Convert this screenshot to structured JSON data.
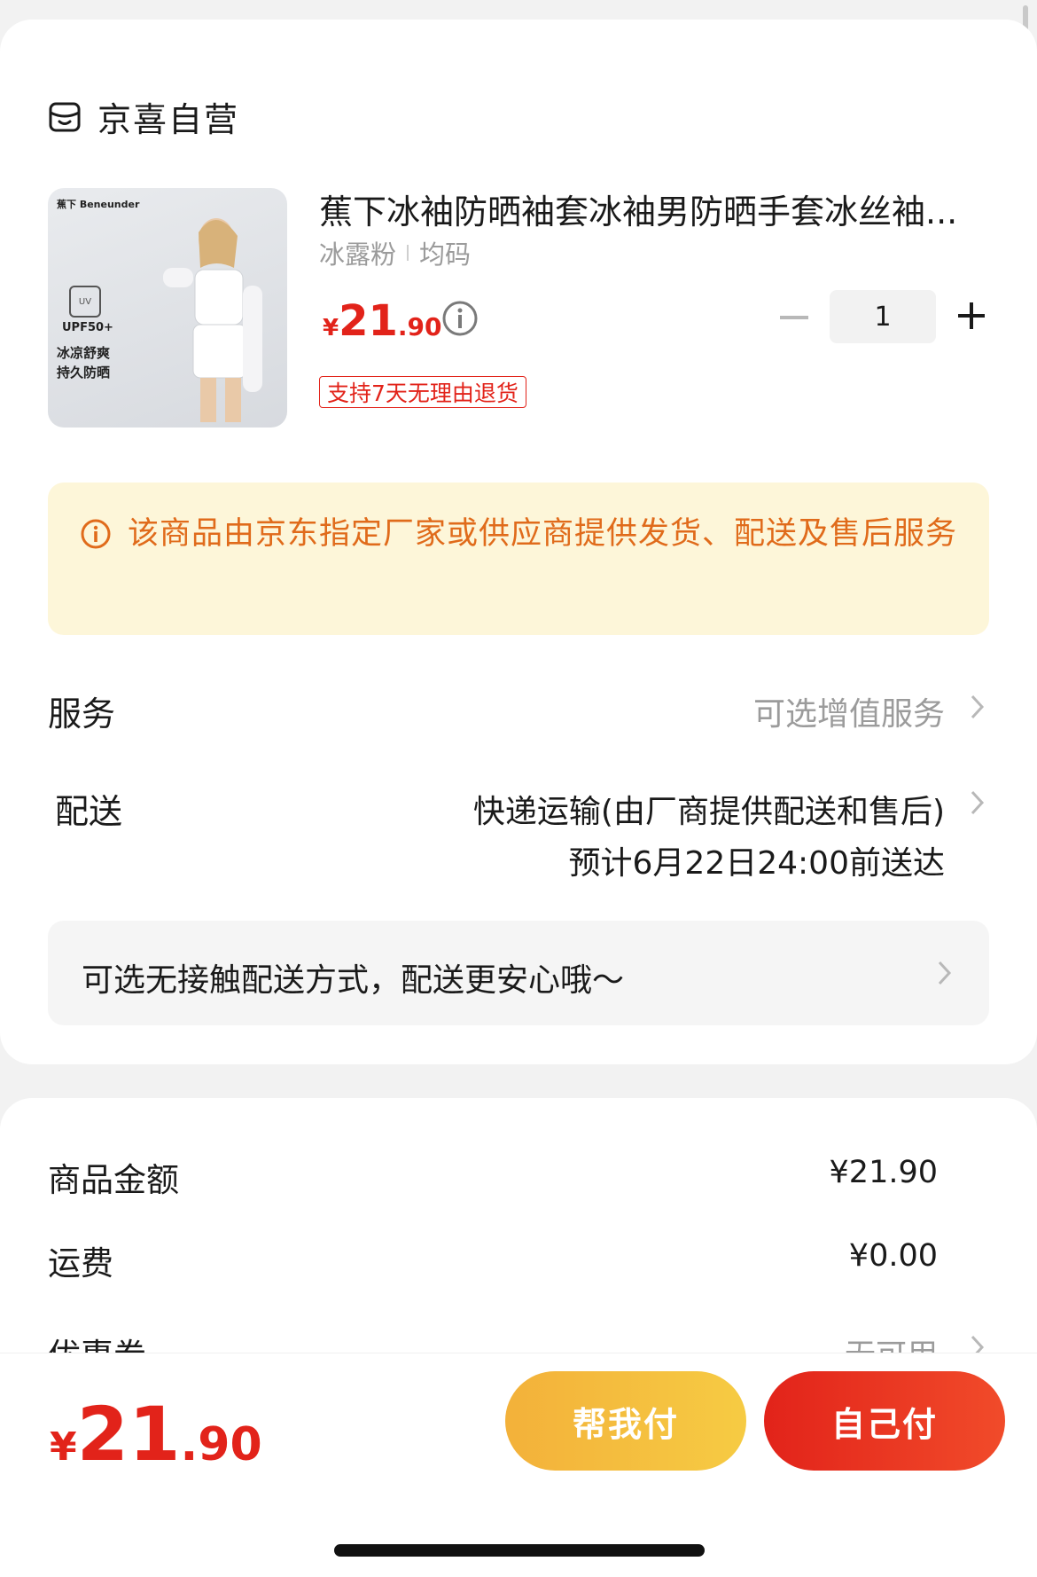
{
  "store": {
    "name": "京喜自营",
    "icon": "store-icon"
  },
  "product": {
    "title": "蕉下冰袖防晒袖套冰袖男防晒手套冰丝袖...",
    "spec_color": "冰露粉",
    "spec_size": "均码",
    "price_currency": "¥",
    "price_int": "21",
    "price_dec": ".90",
    "quantity": "1",
    "return_tag": "支持7天无理由退货",
    "image_text": {
      "brand": "蕉下 Beneunder",
      "uv": "UV",
      "upf": "UPF50+",
      "line1": "冰凉舒爽",
      "line2": "持久防晒"
    }
  },
  "notice": {
    "text": "该商品由京东指定厂家或供应商提供发货、配送及售后服务",
    "color": "#e06b1b"
  },
  "service": {
    "label": "服务",
    "value": "可选增值服务"
  },
  "delivery": {
    "label": "配送",
    "method": "快递运输(由厂商提供配送和售后)",
    "eta": "预计6月22日24:00前送达"
  },
  "contactless": {
    "text": "可选无接触配送方式，配送更安心哦～"
  },
  "summary": {
    "goods_label": "商品金额",
    "goods_value": "¥21.90",
    "shipping_label": "运费",
    "shipping_value": "¥0.00",
    "coupon_label": "优惠券",
    "coupon_value": "无可用"
  },
  "bottom": {
    "total_currency": "¥",
    "total_int": "21",
    "total_dec": ".90",
    "help_pay": "帮我付",
    "self_pay": "自己付"
  },
  "colors": {
    "accent": "#e2231a",
    "help_btn": "#f3b13a",
    "notice_bg": "#fdf6d9"
  }
}
